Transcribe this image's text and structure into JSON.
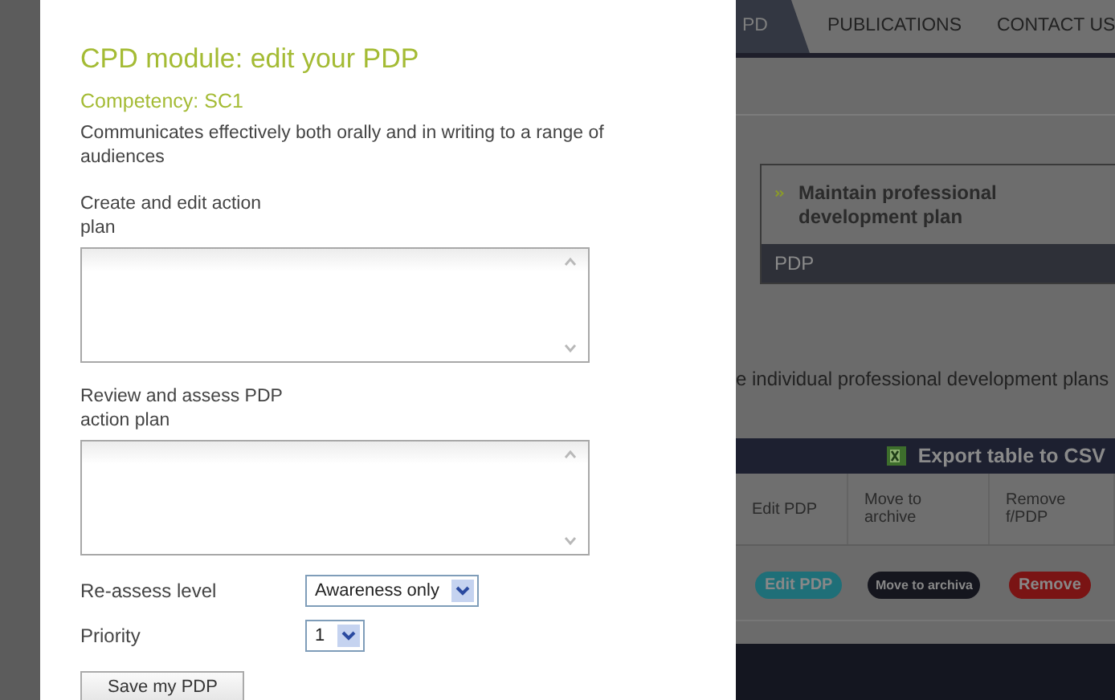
{
  "dialog": {
    "title": "CPD module: edit your PDP",
    "subtitle": "Competency: SC1",
    "description": "Communicates effectively both orally and in writing to a range of audiences",
    "fields": [
      {
        "kind": "textarea",
        "label": "Create and edit action plan"
      },
      {
        "kind": "textarea",
        "label": "Review and assess PDP action plan"
      },
      {
        "kind": "select",
        "label": "Re-assess level",
        "value": "Awareness only"
      },
      {
        "kind": "select",
        "label": "Priority",
        "value": "1"
      }
    ],
    "save_button": "Save my PDP"
  },
  "background": {
    "nav_tabs": [
      {
        "label": "PD",
        "selected": true
      },
      {
        "label": "PUBLICATIONS",
        "selected": false
      },
      {
        "label": "CONTACT US",
        "selected": false
      }
    ],
    "panel": {
      "item": "Maintain professional development plan",
      "bar": "PDP"
    },
    "intro": "e individual professional development plans",
    "table": {
      "toolbar": "Export table to CSV",
      "columns": [
        "Edit PDP",
        "Move to archive",
        "Remove f/PDP"
      ],
      "actions": [
        {
          "label": "Edit PDP",
          "color": "#1f6f78"
        },
        {
          "label": "Move to archiva",
          "color": "#15161e"
        },
        {
          "label": "Remove",
          "color": "#7a1414"
        }
      ]
    }
  }
}
